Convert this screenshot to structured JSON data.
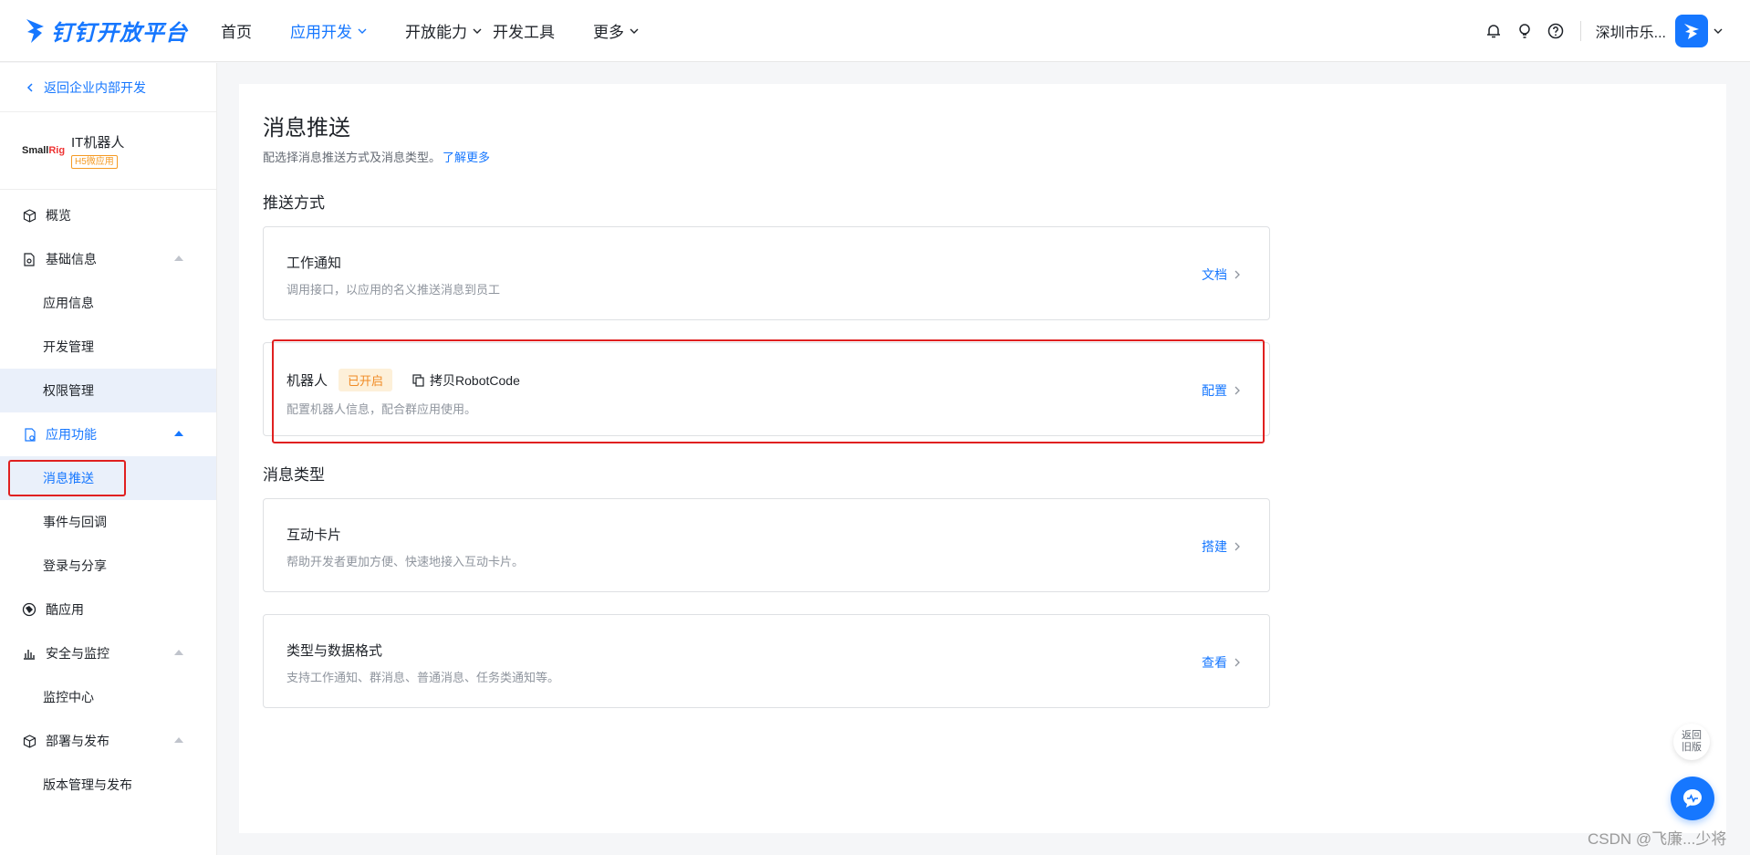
{
  "brand": {
    "name": "钉钉开放平台",
    "accent": "#1677ff"
  },
  "nav": {
    "items": [
      {
        "label": "首页"
      },
      {
        "label": "应用开发"
      },
      {
        "label": "开放能力"
      },
      {
        "label": "开发工具"
      },
      {
        "label": "更多"
      }
    ],
    "active": "应用开发"
  },
  "topRight": {
    "org": "深圳市乐..."
  },
  "sidebar": {
    "back": "返回企业内部开发",
    "app": {
      "logo": "SmallRig",
      "name": "IT机器人",
      "tag": "H5微应用"
    },
    "overview": "概览",
    "basic": {
      "label": "基础信息",
      "items": [
        "应用信息",
        "开发管理",
        "权限管理"
      ]
    },
    "features": {
      "label": "应用功能",
      "items": [
        "消息推送",
        "事件与回调",
        "登录与分享"
      ]
    },
    "cool": "酷应用",
    "security": {
      "label": "安全与监控",
      "items": [
        "监控中心"
      ]
    },
    "deploy": {
      "label": "部署与发布",
      "items": [
        "版本管理与发布"
      ]
    }
  },
  "main": {
    "title": "消息推送",
    "desc": "配选择消息推送方式及消息类型。",
    "learnMore": "了解更多",
    "pushSection": "推送方式",
    "typeSection": "消息类型",
    "cards": {
      "work": {
        "title": "工作通知",
        "desc": "调用接口，以应用的名义推送消息到员工",
        "action": "文档"
      },
      "robot": {
        "title": "机器人",
        "status": "已开启",
        "copy": "拷贝RobotCode",
        "desc": "配置机器人信息，配合群应用使用。",
        "action": "配置"
      },
      "card": {
        "title": "互动卡片",
        "desc": "帮助开发者更加方便、快速地接入互动卡片。",
        "action": "搭建"
      },
      "format": {
        "title": "类型与数据格式",
        "desc": "支持工作通知、群消息、普通消息、任务类通知等。",
        "action": "查看"
      }
    }
  },
  "float": {
    "back": "返回旧版"
  },
  "watermark": "CSDN @飞廉...少将"
}
